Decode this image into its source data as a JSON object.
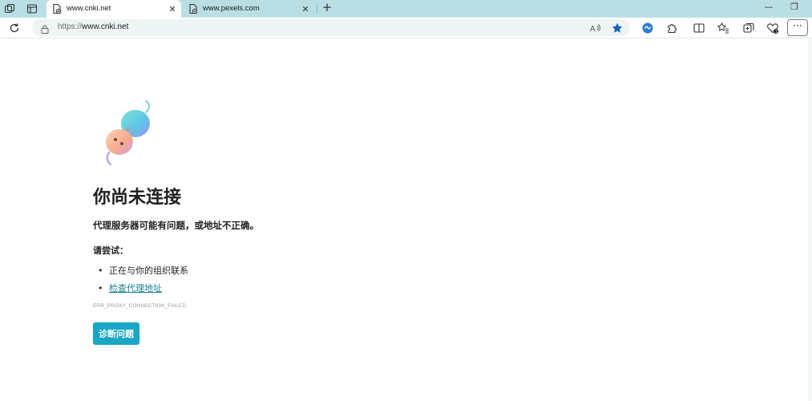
{
  "browser": {
    "tabs": [
      {
        "title": "www.cnki.net",
        "active": true
      },
      {
        "title": "www.pexels.com",
        "active": false
      }
    ],
    "new_tab_label": "+",
    "close_label": "✕",
    "minimize_label": "—",
    "restore_label": "❐",
    "address_bar": {
      "scheme": "https://",
      "host": "www.cnki.net"
    },
    "more_label": "···",
    "accent_color": "#1aa6c6",
    "icons": [
      "workspaces-icon",
      "tab-actions-icon",
      "page-icon",
      "lock-icon",
      "read-aloud-icon",
      "favorite-star-icon",
      "copilot-icon",
      "extensions-icon",
      "split-screen-icon",
      "favorites-icon",
      "collections-icon",
      "browser-essentials-icon",
      "more-icon"
    ]
  },
  "error_page": {
    "heading": "你尚未连接",
    "subtitle": "代理服务器可能有问题，或地址不正确。",
    "try_label": "请尝试：",
    "suggestions": [
      {
        "text": "正在与你的组织联系",
        "link": false
      },
      {
        "text": "检查代理地址",
        "link": true
      }
    ],
    "bullet": "•",
    "error_code": "ERR_PROXY_CONNECTION_FAILED",
    "diagnose_button": "诊断问题"
  }
}
